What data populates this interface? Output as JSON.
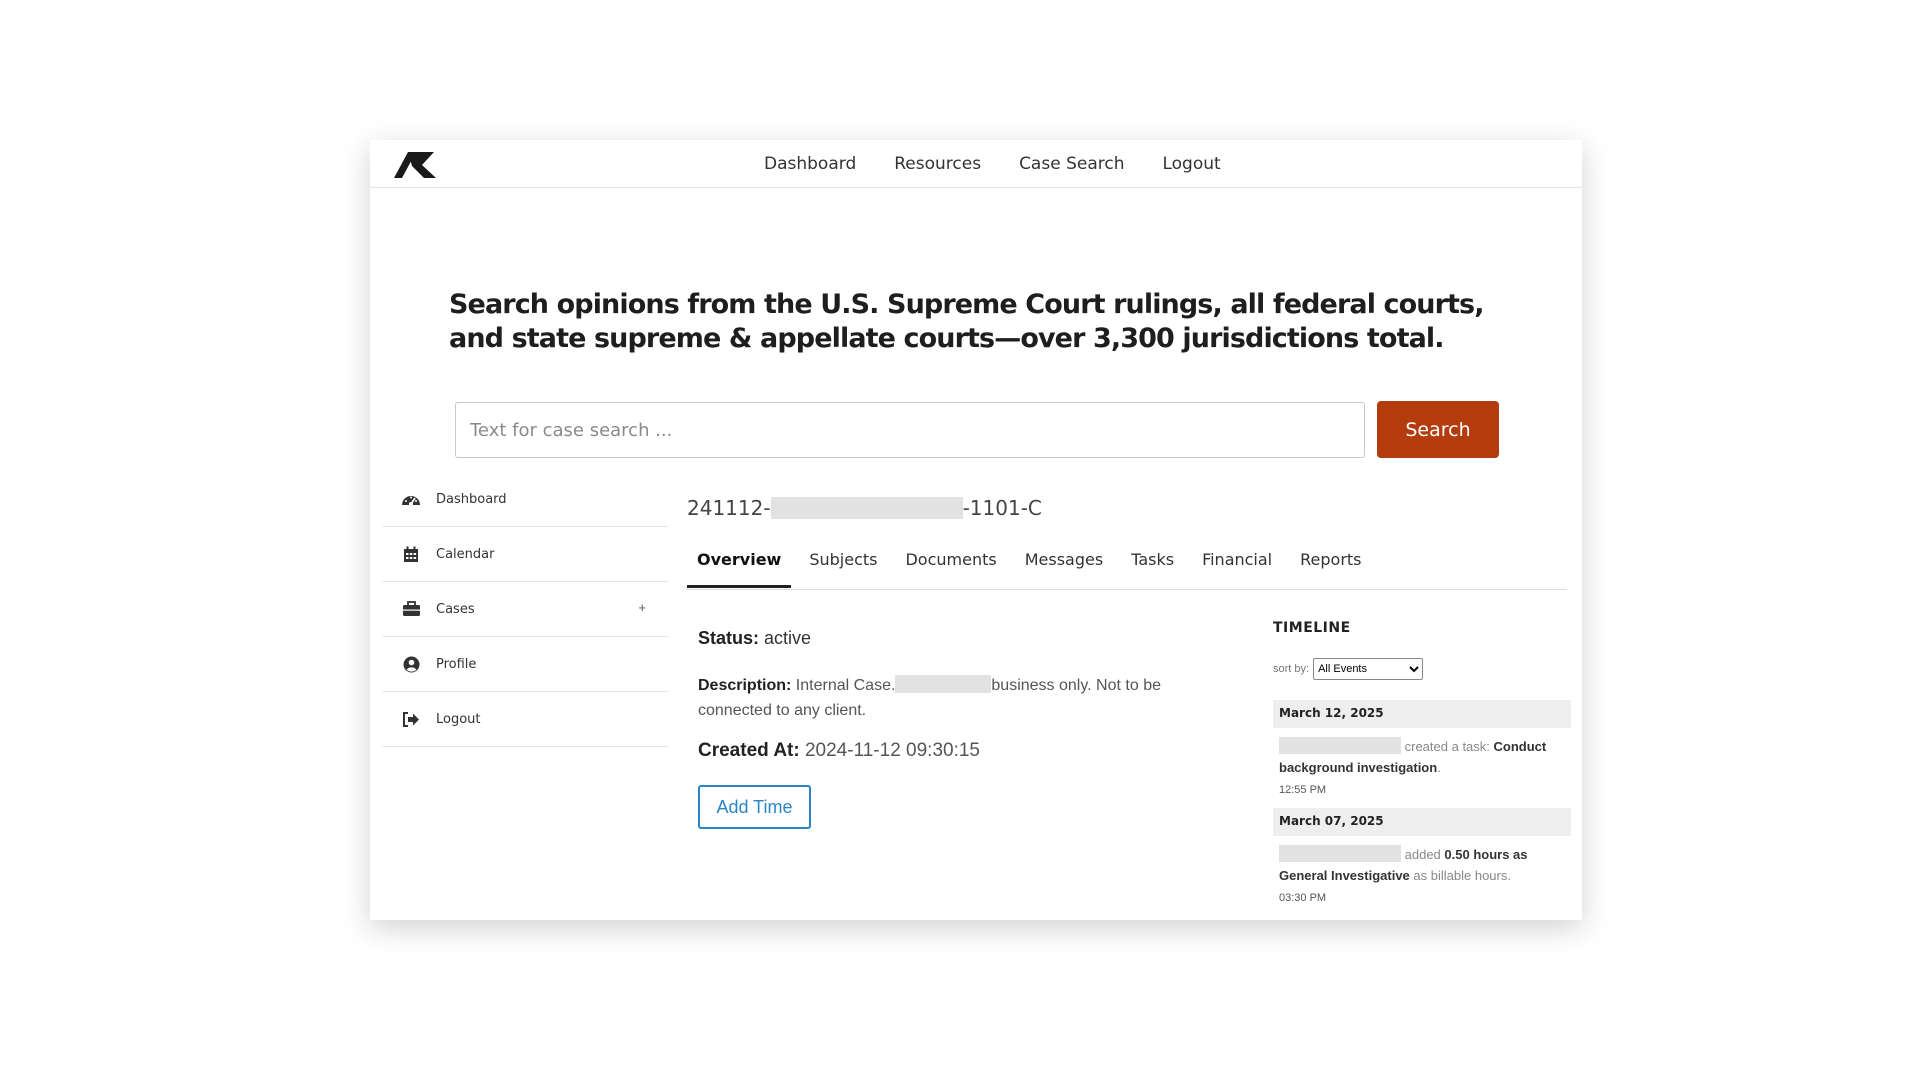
{
  "nav": {
    "links": [
      "Dashboard",
      "Resources",
      "Case Search",
      "Logout"
    ]
  },
  "hero": {
    "headline": "Search opinions from the U.S. Supreme Court rulings, all federal courts, and state supreme & appellate courts—over 3,300 jurisdictions total.",
    "search_placeholder": "Text for case search ...",
    "search_button": "Search"
  },
  "sidebar": {
    "items": [
      {
        "label": "Dashboard",
        "icon": "dashboard-gauge-icon"
      },
      {
        "label": "Calendar",
        "icon": "calendar-icon"
      },
      {
        "label": "Cases",
        "icon": "briefcase-icon",
        "expand": "+"
      },
      {
        "label": "Profile",
        "icon": "user-circle-icon"
      },
      {
        "label": "Logout",
        "icon": "logout-icon"
      }
    ]
  },
  "case": {
    "id_prefix": "241112-",
    "id_suffix": "-1101-C",
    "tabs": [
      "Overview",
      "Subjects",
      "Documents",
      "Messages",
      "Tasks",
      "Financial",
      "Reports"
    ],
    "active_tab": "Overview",
    "status_label": "Status:",
    "status_value": "active",
    "description_label": "Description:",
    "description_part1": "Internal Case.",
    "description_part2": "business only. Not to be connected to any client.",
    "created_label": "Created At:",
    "created_value": "2024-11-12 09:30:15",
    "add_time_button": "Add Time"
  },
  "timeline": {
    "title": "TIMELINE",
    "sort_label": "sort by:",
    "sort_selected": "All Events",
    "events": [
      {
        "date": "March 12, 2025",
        "action": "created a task:",
        "detail": "Conduct background investigation",
        "end": ".",
        "time": "12:55 PM"
      },
      {
        "date": "March 07, 2025",
        "action": "added",
        "detail": "0.50 hours as General Investigative",
        "end": "as billable hours.",
        "time": "03:30 PM"
      }
    ]
  },
  "colors": {
    "search_button": "#b43c0c",
    "add_time_border": "#2a86c6",
    "text_dark": "#1e1e1e"
  }
}
